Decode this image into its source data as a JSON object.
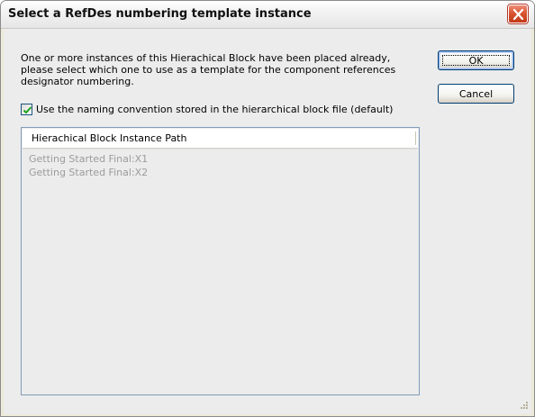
{
  "window": {
    "title": "Select a RefDes numbering template instance"
  },
  "message": {
    "lines": [
      "One or more instances of this Hierachical Block have been placed already,",
      "please select which one to use as a template for the component references",
      "designator numbering."
    ]
  },
  "checkbox": {
    "label": "Use the naming convention stored in the hierarchical block file (default)",
    "checked": true
  },
  "buttons": {
    "ok_label": "OK",
    "cancel_label": "Cancel"
  },
  "list": {
    "column_header": "Hierachical Block Instance Path",
    "rows": [
      "Getting Started Final:X1",
      "Getting Started Final:X2"
    ]
  },
  "colors": {
    "dialog_background": "#ececec",
    "close_button": "#d9542f",
    "disabled_text": "#9c9c9c",
    "checkmark": "#21a121"
  }
}
